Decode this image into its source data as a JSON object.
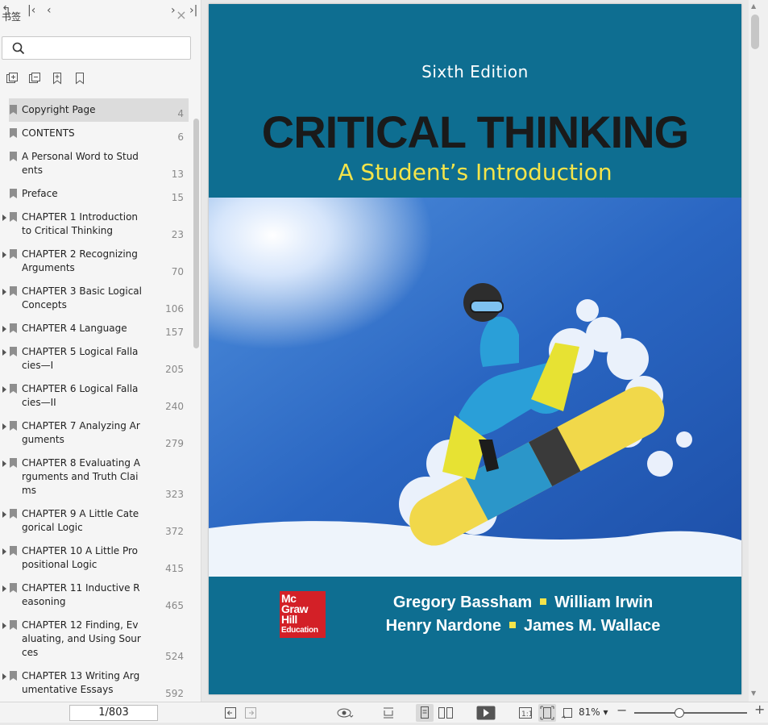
{
  "sidebar": {
    "title": "书签",
    "search_placeholder": "",
    "bookmarks": [
      {
        "label": "Copyright Page",
        "page": "4",
        "expandable": false,
        "selected": true
      },
      {
        "label": "CONTENTS",
        "page": "6",
        "expandable": false
      },
      {
        "label": "A Personal Word to Students",
        "page": "13",
        "expandable": false
      },
      {
        "label": "Preface",
        "page": "15",
        "expandable": false
      },
      {
        "label": "CHAPTER 1 Introduction to Critical Thinking",
        "page": "23",
        "expandable": true
      },
      {
        "label": "CHAPTER 2 Recognizing Arguments",
        "page": "70",
        "expandable": true
      },
      {
        "label": "CHAPTER 3 Basic Logical Concepts",
        "page": "106",
        "expandable": true
      },
      {
        "label": "CHAPTER 4 Language",
        "page": "157",
        "expandable": true
      },
      {
        "label": "CHAPTER 5 Logical Fallacies—I",
        "page": "205",
        "expandable": true
      },
      {
        "label": "CHAPTER 6 Logical Fallacies—II",
        "page": "240",
        "expandable": true
      },
      {
        "label": "CHAPTER 7 Analyzing Arguments",
        "page": "279",
        "expandable": true
      },
      {
        "label": "CHAPTER 8 Evaluating Arguments and Truth Claims",
        "page": "323",
        "expandable": true
      },
      {
        "label": "CHAPTER 9 A Little Categorical Logic",
        "page": "372",
        "expandable": true
      },
      {
        "label": "CHAPTER 10 A Little Propositional Logic",
        "page": "415",
        "expandable": true
      },
      {
        "label": "CHAPTER 11 Inductive Reasoning",
        "page": "465",
        "expandable": true
      },
      {
        "label": "CHAPTER 12 Finding, Evaluating, and Using Sources",
        "page": "524",
        "expandable": true
      },
      {
        "label": "CHAPTER 13 Writing Argumentative Essays",
        "page": "592",
        "expandable": true
      }
    ]
  },
  "cover": {
    "edition": "Sixth Edition",
    "title": "CRITICAL THINKING",
    "subtitle": "A Student’s Introduction",
    "authors_line1_a": "Gregory Bassham",
    "authors_line1_b": "William Irwin",
    "authors_line2_a": "Henry Nardone",
    "authors_line2_b": "James M. Wallace",
    "publisher_logo": [
      "Mc",
      "Graw",
      "Hill",
      "Education"
    ],
    "colors": {
      "background": "#0e6e91",
      "title": "#1a1a1a",
      "subtitle": "#f4e44a",
      "logo": "#d32027"
    }
  },
  "toolbar": {
    "page_indicator": "1/803",
    "zoom": "81%",
    "zoom_fraction": 0.4
  }
}
